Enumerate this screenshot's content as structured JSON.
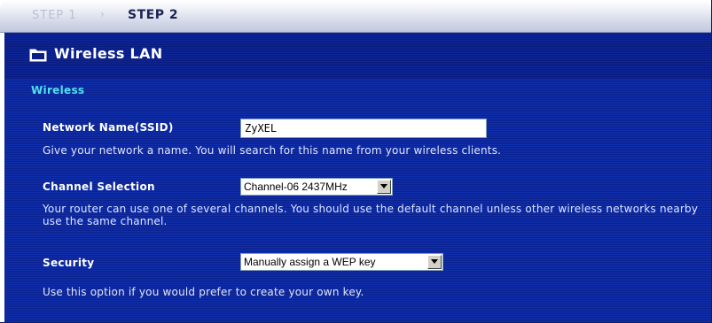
{
  "wizard": {
    "step1_label": "STEP 1",
    "step2_label": "STEP 2",
    "separator_icon": "chevron-right-icon"
  },
  "page": {
    "title": "Wireless LAN",
    "title_icon": "folder-icon"
  },
  "section": {
    "heading": "Wireless"
  },
  "ssid": {
    "label": "Network Name(SSID)",
    "value": "ZyXEL",
    "description": "Give your network a name. You will search for this name from your wireless clients."
  },
  "channel": {
    "label": "Channel Selection",
    "selected": "Channel-06 2437MHz",
    "description": "Your router can use one of several channels. You should use the default channel unless other wireless networks nearby use the same channel."
  },
  "security": {
    "label": "Security",
    "selected": "Manually assign a WEP key",
    "description": "Use this option if you would prefer to create your own key."
  },
  "colors": {
    "panel_blue": "#0b2497",
    "section_cyan": "#51e0f0",
    "active_step": "#1c2454",
    "inactive_step": "#b9bfd4"
  }
}
